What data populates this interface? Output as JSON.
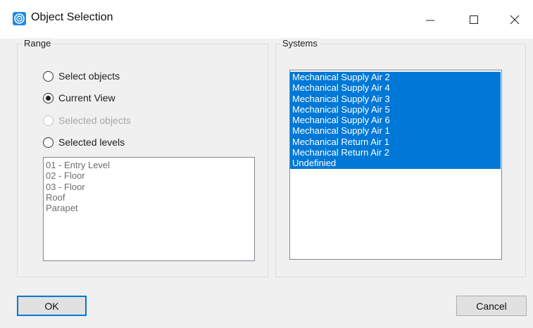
{
  "window": {
    "title": "Object Selection",
    "app_icon": "circle-logo-icon",
    "minimize_icon": "minimize-icon",
    "maximize_icon": "maximize-icon",
    "close_icon": "close-icon"
  },
  "range": {
    "label": "Range",
    "options": [
      {
        "label": "Select objects",
        "checked": false,
        "enabled": true
      },
      {
        "label": "Current View",
        "checked": true,
        "enabled": true
      },
      {
        "label": "Selected objects",
        "checked": false,
        "enabled": false
      },
      {
        "label": "Selected levels",
        "checked": false,
        "enabled": true
      }
    ],
    "levels": [
      "01 - Entry Level",
      "02 - Floor",
      "03 - Floor",
      "Roof",
      "Parapet"
    ]
  },
  "systems": {
    "label": "Systems",
    "items": [
      "Mechanical Supply Air 2",
      "Mechanical Supply Air 4",
      "Mechanical Supply Air 3",
      "Mechanical Supply Air 5",
      "Mechanical Supply Air 6",
      "Mechanical Supply Air 1",
      "Mechanical Return Air 1",
      "Mechanical Return Air 2",
      "Undefinied"
    ],
    "selected_color": "#0078d7"
  },
  "buttons": {
    "ok_label": "OK",
    "cancel_label": "Cancel"
  }
}
